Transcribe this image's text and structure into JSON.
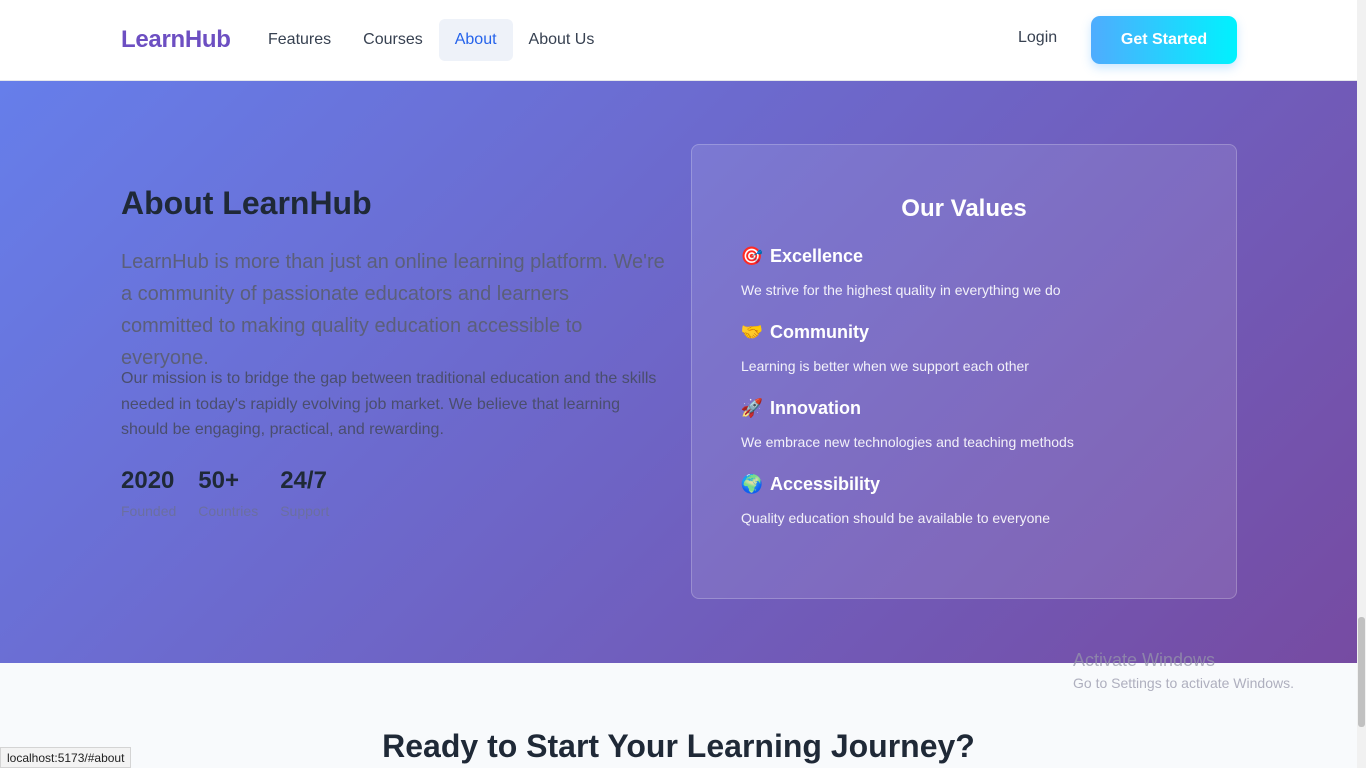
{
  "navbar": {
    "brand": "LearnHub",
    "links": [
      "Features",
      "Courses",
      "About",
      "About Us"
    ],
    "active_link": "About",
    "login_label": "Login",
    "cta_label": "Get Started"
  },
  "about": {
    "title": "About LearnHub",
    "lead": "LearnHub is more than just an online learning platform. We're a community of passionate educators and learners committed to making quality education accessible to everyone.",
    "mission": "Our mission is to bridge the gap between traditional education and the skills needed in today's rapidly evolving job market. We believe that learning should be engaging, practical, and rewarding.",
    "stats": [
      {
        "value": "2020",
        "label": "Founded"
      },
      {
        "value": "50+",
        "label": "Countries"
      },
      {
        "value": "24/7",
        "label": "Support"
      }
    ]
  },
  "values": {
    "title": "Our Values",
    "items": [
      {
        "icon": "🎯",
        "icon_name": "target-icon",
        "name": "Excellence",
        "desc": "We strive for the highest quality in everything we do"
      },
      {
        "icon": "🤝",
        "icon_name": "handshake-icon",
        "name": "Community",
        "desc": "Learning is better when we support each other"
      },
      {
        "icon": "🚀",
        "icon_name": "rocket-icon",
        "name": "Innovation",
        "desc": "We embrace new technologies and teaching methods"
      },
      {
        "icon": "🌍",
        "icon_name": "globe-icon",
        "name": "Accessibility",
        "desc": "Quality education should be available to everyone"
      }
    ]
  },
  "cta_section": {
    "heading": "Ready to Start Your Learning Journey?"
  },
  "browser": {
    "status_url": "localhost:5173/#about"
  },
  "watermark": {
    "line1": "Activate Windows",
    "line2": "Go to Settings to activate Windows."
  }
}
